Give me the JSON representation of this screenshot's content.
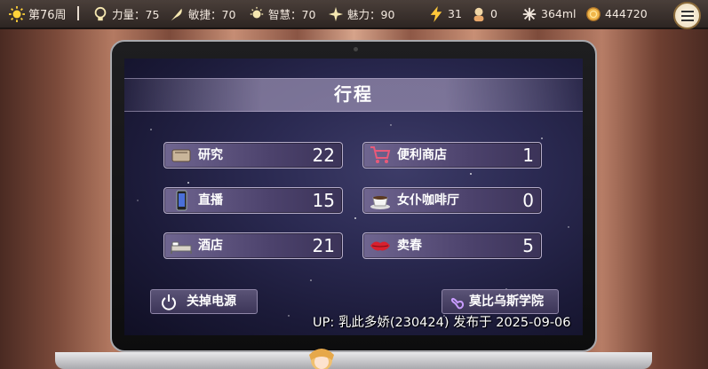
{
  "topbar": {
    "week": "第76周",
    "strength": "力量：75",
    "agility": "敏捷：70",
    "wisdom": "智慧：70",
    "charm": "魅力：90",
    "energy": "31",
    "followers": "0",
    "liquid": "364ml",
    "money": "444720"
  },
  "screen": {
    "title": "行程",
    "items": [
      {
        "label": "研究",
        "value": "22"
      },
      {
        "label": "便利商店",
        "value": "1"
      },
      {
        "label": "直播",
        "value": "15"
      },
      {
        "label": "女仆咖啡厅",
        "value": "0"
      },
      {
        "label": "酒店",
        "value": "21"
      },
      {
        "label": "卖春",
        "value": "5"
      }
    ],
    "power_label": "关掉电源",
    "academy_label": "莫比乌斯学院"
  },
  "watermark": "UP: 乳此多娇(230424) 发布于 2025-09-06",
  "colors": {
    "accent": "#4c426c",
    "topbar": "#2d2522"
  }
}
